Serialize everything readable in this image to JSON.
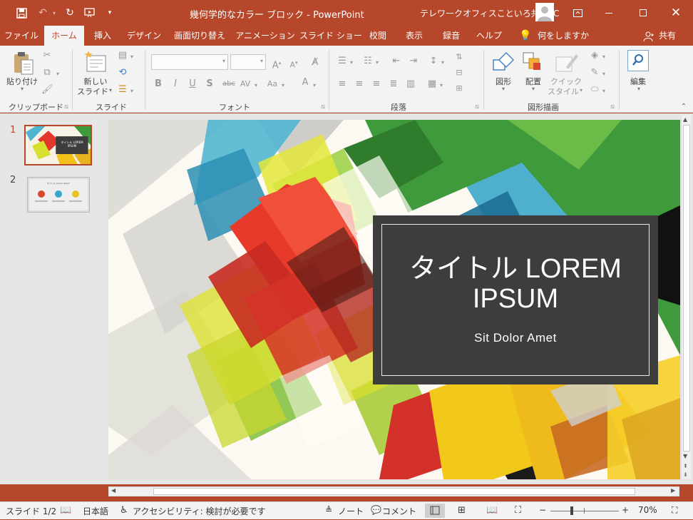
{
  "window": {
    "title": "幾何学的なカラー ブロック  -  PowerPoint",
    "account": "テレワークオフィスこといろ共有PC"
  },
  "tabs": [
    "ファイル",
    "ホーム",
    "挿入",
    "デザイン",
    "画面切り替え",
    "アニメーション",
    "スライド ショー",
    "校閲",
    "表示",
    "録音",
    "ヘルプ"
  ],
  "search_label": "何をしますか",
  "share_label": "共有",
  "ribbon": {
    "paste_label": "貼り付け",
    "new_slide_line1": "新しい",
    "new_slide_line2": "スライド",
    "shapes_label": "図形",
    "arrange_label": "配置",
    "quick_style_line1": "クイック",
    "quick_style_line2": "スタイル",
    "edit_label": "編集",
    "groups": {
      "clipboard": "クリップボード",
      "slides": "スライド",
      "font": "フォント",
      "paragraph": "段落",
      "drawing": "図形描画"
    }
  },
  "thumbnails": [
    {
      "number": "1",
      "title": "タイトル LOREM IPSUM"
    },
    {
      "number": "2",
      "title": "タイトル Lorem Ipsum"
    }
  ],
  "slide": {
    "title": "タイトル LOREM IPSUM",
    "subtitle": "Sit Dolor Amet"
  },
  "status": {
    "slide_counter": "スライド 1/2",
    "language": "日本語",
    "accessibility": "アクセシビリティ: 検討が必要です",
    "notes": "ノート",
    "comments": "コメント",
    "zoom": "70%"
  },
  "colors": {
    "accent": "#b7472a",
    "ribbon_bg": "#f3f3f3",
    "title_box_bg": "#3d3d3d"
  }
}
